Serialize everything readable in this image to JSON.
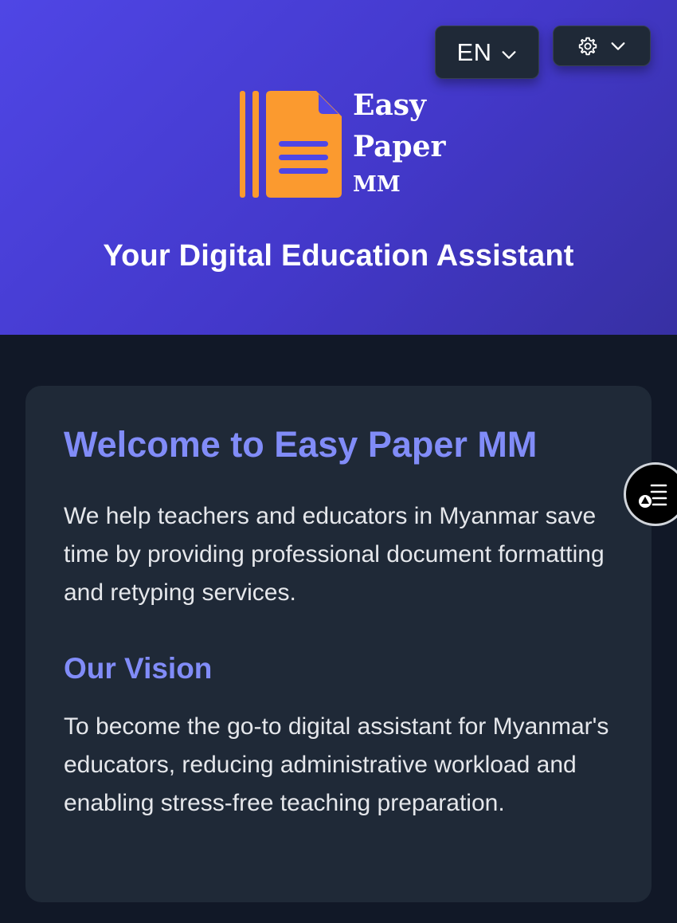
{
  "header": {
    "language_label": "EN",
    "language_chevron_icon": "chevron-down-icon",
    "settings_icon": "gear-icon",
    "settings_chevron_icon": "chevron-down-icon",
    "background_gradient": [
      "#4f46e5",
      "#3730a3"
    ]
  },
  "logo": {
    "icon": "document-stack-icon",
    "line1": "Easy",
    "line2": "Paper",
    "line3": "MM",
    "icon_color": "#fb9a2f"
  },
  "tagline": "Your Digital Education Assistant",
  "card": {
    "title": "Welcome to Easy Paper MM",
    "intro": "We help teachers and educators in Myanmar save time by providing professional document formatting and retyping services.",
    "vision_heading": "Our Vision",
    "vision_text": "To become the go-to digital assistant for Myanmar's educators, reducing administrative workload and enabling stress-free teaching preparation.",
    "accent_color": "#818cf8"
  },
  "floating_button": {
    "icon": "shapes-list-icon"
  }
}
